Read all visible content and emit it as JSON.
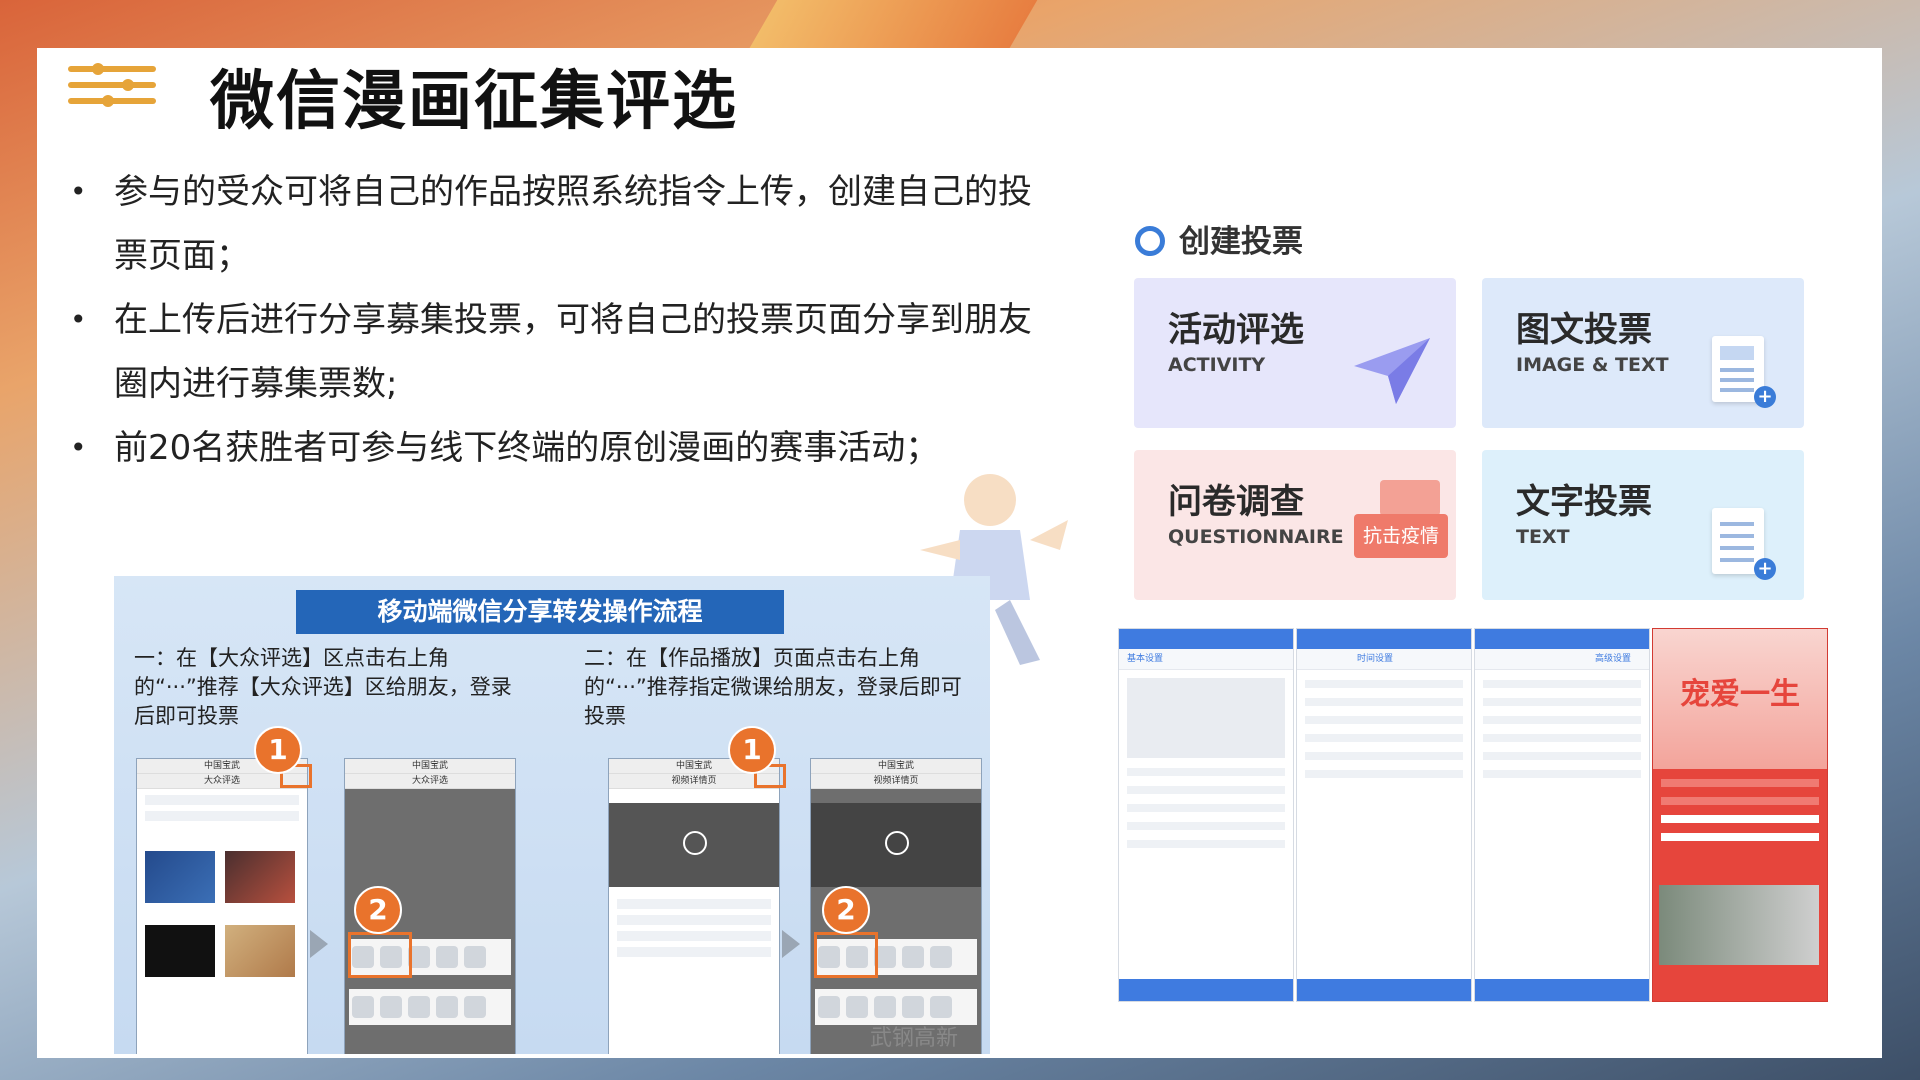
{
  "page": {
    "title": "微信漫画征集评选",
    "bullets": [
      "参与的受众可将自己的作品按照系统指令上传，创建自己的投票页面；",
      "在上传后进行分享募集投票，可将自己的投票页面分享到朋友圈内进行募集票数;",
      "前20名获胜者可参与线下终端的原创漫画的赛事活动；"
    ]
  },
  "flow": {
    "title": "移动端微信分享转发操作流程",
    "step1": "一：在【大众评选】区点击右上角的“···”推荐【大众评选】区给朋友，登录后即可投票",
    "step2": "二：在【作品播放】页面点击右上角的“···”推荐指定微课给朋友，登录后即可投票",
    "badge1": "1",
    "badge2": "2",
    "phone_title": "中国宝武",
    "phone1_sub": "大众评选",
    "phone3_sub": "视频详情页",
    "watermark": "武钢高新"
  },
  "vote": {
    "heading": "创建投票",
    "cards": [
      {
        "cn": "活动评选",
        "en": "ACTIVITY"
      },
      {
        "cn": "图文投票",
        "en": "IMAGE & TEXT"
      },
      {
        "cn": "问卷调查",
        "en": "QUESTIONNAIRE"
      },
      {
        "cn": "文字投票",
        "en": "TEXT"
      }
    ],
    "tag": "抗击疫情",
    "screen_titles": [
      "基本设置",
      "时间设置",
      "高级设置"
    ],
    "poster_title": "宠爱一生",
    "colors": {
      "accent": "#3a7cd8",
      "title_icon": "#e6a439",
      "badge": "#e9732c",
      "flow_title_bg": "#2466b8"
    }
  }
}
